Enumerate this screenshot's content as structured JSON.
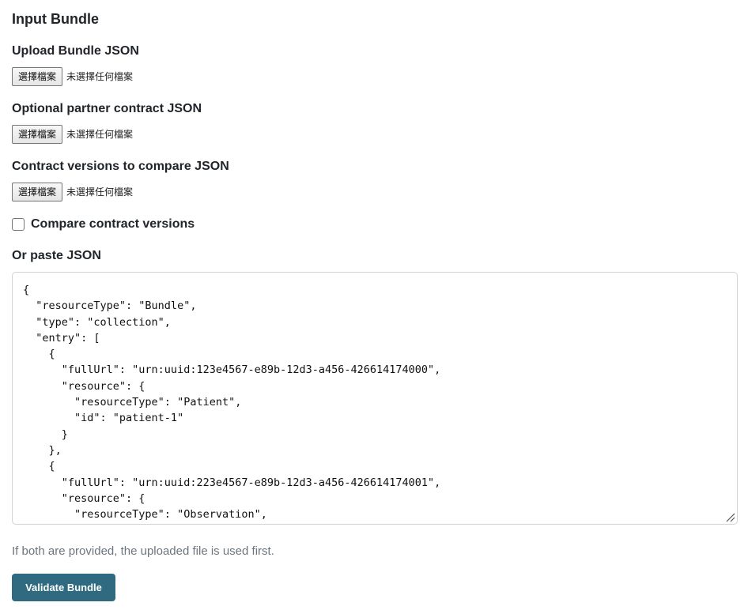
{
  "section": {
    "title": "Input Bundle"
  },
  "fields": [
    {
      "label": "Upload Bundle JSON",
      "button_label": "選擇檔案",
      "status": "未選擇任何檔案"
    },
    {
      "label": "Optional partner contract JSON",
      "button_label": "選擇檔案",
      "status": "未選擇任何檔案"
    },
    {
      "label": "Contract versions to compare JSON",
      "button_label": "選擇檔案",
      "status": "未選擇任何檔案"
    }
  ],
  "compare_checkbox": {
    "label": "Compare contract versions",
    "checked": false
  },
  "paste": {
    "label": "Or paste JSON",
    "value": "{\n  \"resourceType\": \"Bundle\",\n  \"type\": \"collection\",\n  \"entry\": [\n    {\n      \"fullUrl\": \"urn:uuid:123e4567-e89b-12d3-a456-426614174000\",\n      \"resource\": {\n        \"resourceType\": \"Patient\",\n        \"id\": \"patient-1\"\n      }\n    },\n    {\n      \"fullUrl\": \"urn:uuid:223e4567-e89b-12d3-a456-426614174001\",\n      \"resource\": {\n        \"resourceType\": \"Observation\","
  },
  "help_text": "If both are provided, the uploaded file is used first.",
  "actions": {
    "validate_label": "Validate Bundle",
    "validate_color": "#2f6a80"
  },
  "icons": {
    "resize": "resize-grip-icon"
  }
}
